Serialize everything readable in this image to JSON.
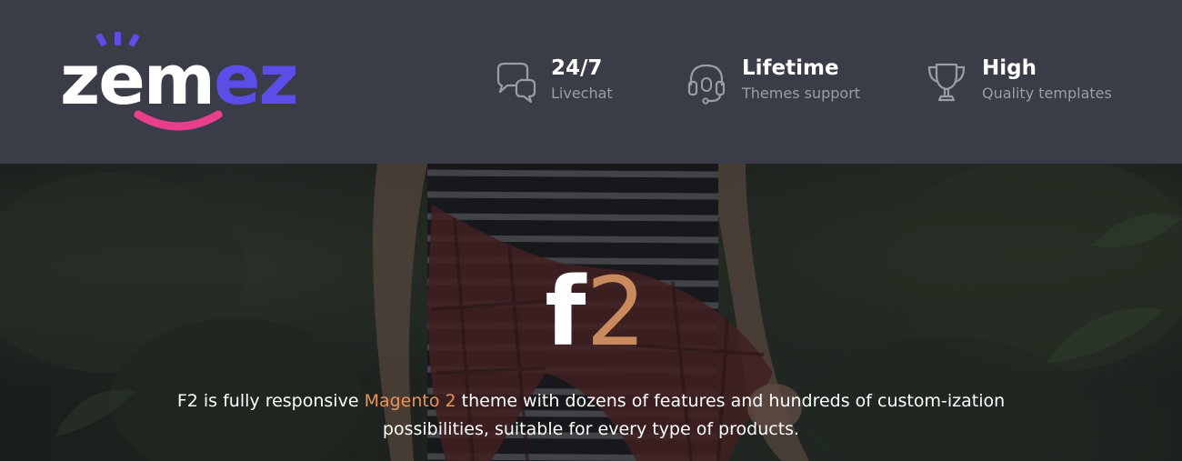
{
  "header": {
    "logo": {
      "part1": "zem",
      "part2": "ez",
      "colors": {
        "white": "#ffffff",
        "accent": "#5b4de8",
        "smile": "#e83e8c"
      }
    },
    "features": [
      {
        "icon": "chat-bubbles-icon",
        "title": "24/7",
        "subtitle": "Livechat"
      },
      {
        "icon": "headset-icon",
        "title": "Lifetime",
        "subtitle": "Themes support"
      },
      {
        "icon": "trophy-icon",
        "title": "High",
        "subtitle": "Quality templates"
      }
    ]
  },
  "hero": {
    "brand": {
      "letter": "f",
      "number": "2",
      "number_color": "#c98a5e"
    },
    "tagline": {
      "before": "F2 is fully responsive ",
      "highlight": "Magento 2",
      "after": " theme with dozens of features and hundreds of custom-ization possibilities, suitable for every type of products.",
      "highlight_color": "#e8935a"
    }
  },
  "colors": {
    "header_bg": "#3a3d48",
    "muted_text": "#9a9da8"
  }
}
